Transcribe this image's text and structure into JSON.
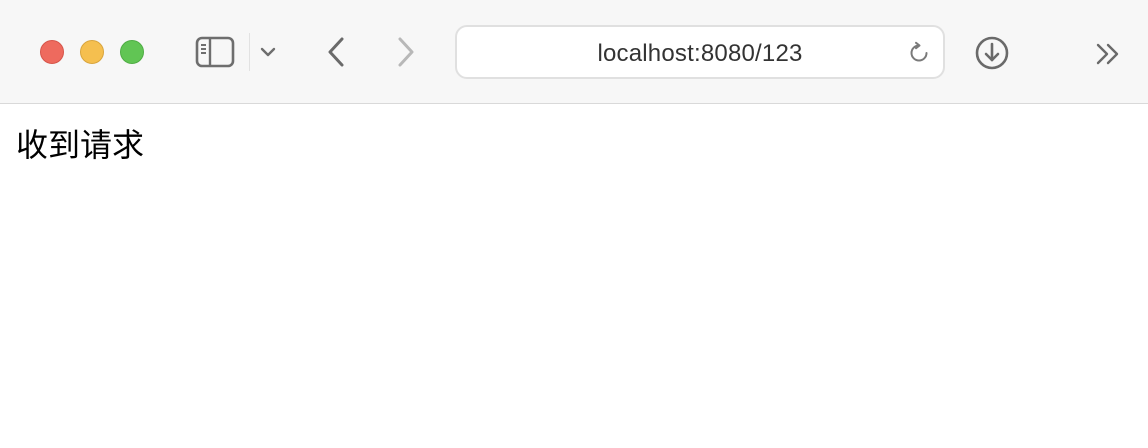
{
  "browser": {
    "address_bar": {
      "url": "localhost:8080/123"
    },
    "icons": {
      "close": "close-window",
      "minimize": "minimize-window",
      "zoom": "zoom-window",
      "sidebar": "sidebar-icon",
      "chevron": "chevron-down-icon",
      "back": "back-arrow-icon",
      "forward": "forward-arrow-icon",
      "reload": "reload-icon",
      "download": "download-icon",
      "more": "double-chevron-right-icon"
    },
    "colors": {
      "close": "#ee6a5e",
      "minimize": "#f5bf4f",
      "zoom": "#61c554"
    }
  },
  "page": {
    "body_text": "收到请求"
  }
}
